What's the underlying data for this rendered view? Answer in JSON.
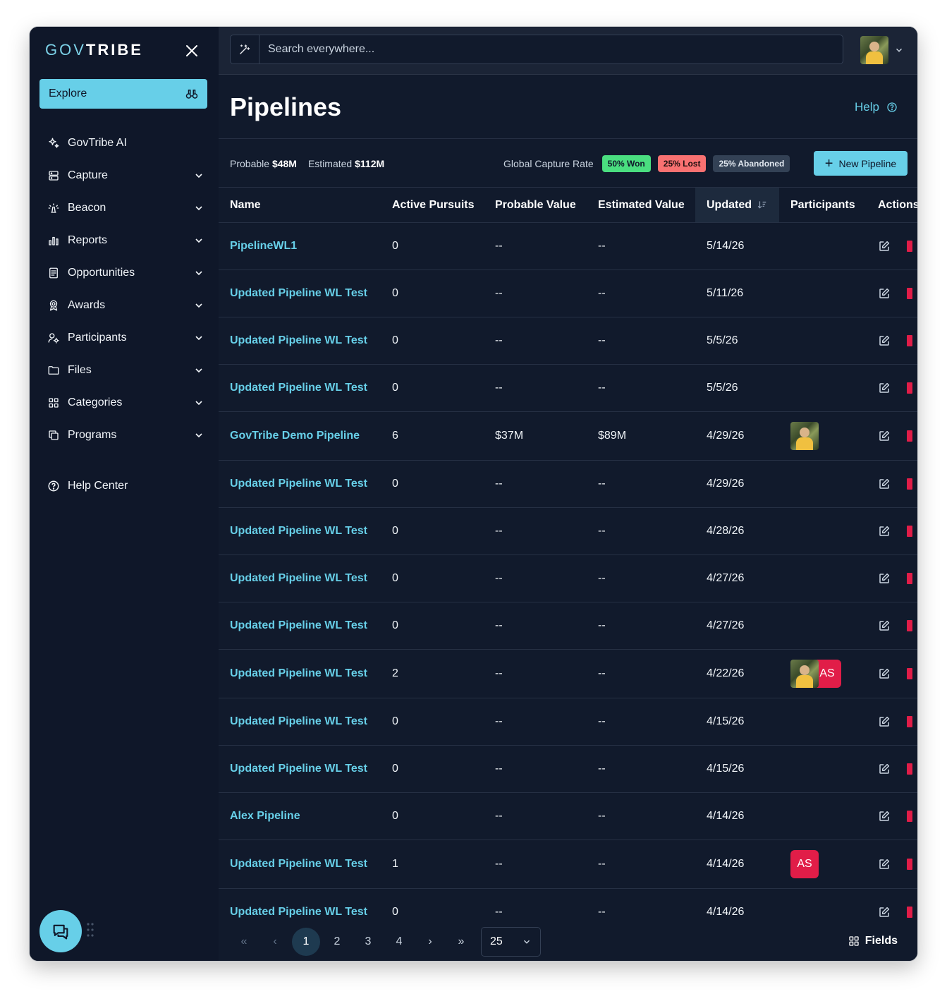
{
  "sidebar": {
    "logo_gov": "GOV",
    "logo_tribe": "TRIBE",
    "explore_label": "Explore",
    "items": [
      {
        "label": "GovTribe AI",
        "icon": "sparkles-icon",
        "expandable": false
      },
      {
        "label": "Capture",
        "icon": "server-icon",
        "expandable": true
      },
      {
        "label": "Beacon",
        "icon": "beacon-icon",
        "expandable": true
      },
      {
        "label": "Reports",
        "icon": "bar-chart-icon",
        "expandable": true
      },
      {
        "label": "Opportunities",
        "icon": "document-icon",
        "expandable": true
      },
      {
        "label": "Awards",
        "icon": "award-icon",
        "expandable": true
      },
      {
        "label": "Participants",
        "icon": "user-gear-icon",
        "expandable": true
      },
      {
        "label": "Files",
        "icon": "folder-icon",
        "expandable": true
      },
      {
        "label": "Categories",
        "icon": "grid-icon",
        "expandable": true
      },
      {
        "label": "Programs",
        "icon": "copy-icon",
        "expandable": true
      }
    ],
    "help_center_label": "Help Center"
  },
  "search": {
    "placeholder": "Search everywhere..."
  },
  "page": {
    "title": "Pipelines",
    "help_label": "Help"
  },
  "stats": {
    "probable_label": "Probable",
    "probable_value": "$48M",
    "estimated_label": "Estimated",
    "estimated_value": "$112M",
    "capture_rate_label": "Global Capture Rate",
    "won": "50% Won",
    "lost": "25% Lost",
    "abandoned": "25% Abandoned",
    "new_pipeline_label": "New Pipeline"
  },
  "table": {
    "columns": [
      "Name",
      "Active Pursuits",
      "Probable Value",
      "Estimated Value",
      "Updated",
      "Participants",
      "Actions"
    ],
    "rows": [
      {
        "name": "PipelineWL1",
        "pursuits": "0",
        "probable": "--",
        "estimated": "--",
        "updated": "5/14/26",
        "participants": []
      },
      {
        "name": "Updated Pipeline WL Test",
        "pursuits": "0",
        "probable": "--",
        "estimated": "--",
        "updated": "5/11/26",
        "participants": []
      },
      {
        "name": "Updated Pipeline WL Test",
        "pursuits": "0",
        "probable": "--",
        "estimated": "--",
        "updated": "5/5/26",
        "participants": []
      },
      {
        "name": "Updated Pipeline WL Test",
        "pursuits": "0",
        "probable": "--",
        "estimated": "--",
        "updated": "5/5/26",
        "participants": []
      },
      {
        "name": "GovTribe Demo Pipeline",
        "pursuits": "6",
        "probable": "$37M",
        "estimated": "$89M",
        "updated": "4/29/26",
        "participants": [
          "photo"
        ]
      },
      {
        "name": "Updated Pipeline WL Test",
        "pursuits": "0",
        "probable": "--",
        "estimated": "--",
        "updated": "4/29/26",
        "participants": []
      },
      {
        "name": "Updated Pipeline WL Test",
        "pursuits": "0",
        "probable": "--",
        "estimated": "--",
        "updated": "4/28/26",
        "participants": []
      },
      {
        "name": "Updated Pipeline WL Test",
        "pursuits": "0",
        "probable": "--",
        "estimated": "--",
        "updated": "4/27/26",
        "participants": []
      },
      {
        "name": "Updated Pipeline WL Test",
        "pursuits": "0",
        "probable": "--",
        "estimated": "--",
        "updated": "4/27/26",
        "participants": []
      },
      {
        "name": "Updated Pipeline WL Test",
        "pursuits": "2",
        "probable": "--",
        "estimated": "--",
        "updated": "4/22/26",
        "participants": [
          "photo",
          "AS"
        ]
      },
      {
        "name": "Updated Pipeline WL Test",
        "pursuits": "0",
        "probable": "--",
        "estimated": "--",
        "updated": "4/15/26",
        "participants": []
      },
      {
        "name": "Updated Pipeline WL Test",
        "pursuits": "0",
        "probable": "--",
        "estimated": "--",
        "updated": "4/15/26",
        "participants": []
      },
      {
        "name": "Alex Pipeline",
        "pursuits": "0",
        "probable": "--",
        "estimated": "--",
        "updated": "4/14/26",
        "participants": []
      },
      {
        "name": "Updated Pipeline WL Test",
        "pursuits": "1",
        "probable": "--",
        "estimated": "--",
        "updated": "4/14/26",
        "participants": [
          "AS"
        ]
      },
      {
        "name": "Updated Pipeline WL Test",
        "pursuits": "0",
        "probable": "--",
        "estimated": "--",
        "updated": "4/14/26",
        "participants": []
      }
    ]
  },
  "pagination": {
    "pages": [
      "1",
      "2",
      "3",
      "4"
    ],
    "current": "1",
    "per_page": "25",
    "fields_label": "Fields"
  },
  "colors": {
    "accent": "#67cfe8",
    "background": "#111a2c",
    "won": "#4ade80",
    "lost": "#f87171",
    "avatar_initials": "#e11d48"
  }
}
